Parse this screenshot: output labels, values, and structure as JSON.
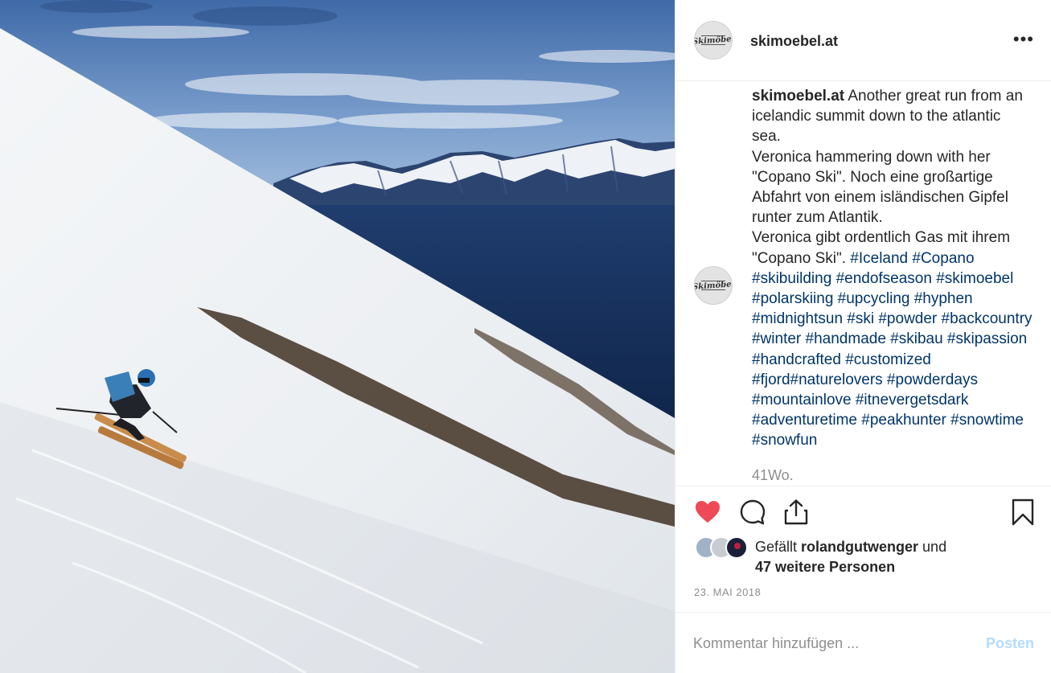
{
  "post": {
    "image": {
      "description": "skier descending snowy slope above fjord"
    },
    "author": {
      "username": "skimoebel.at",
      "avatar_logo_text": "Skimöbel"
    },
    "menu_icon": "more-dots-icon",
    "caption": {
      "username": "skimoebel.at",
      "text": " Another great run from an icelandic summit down to the atlantic sea.\nVeronica hammering down with her \"Copano Ski\". Noch eine großartige Abfahrt von einem isländischen Gipfel runter zum Atlantik.\nVeronica gibt ordentlich Gas mit ihrem \"Copano Ski\". ",
      "hashtags": "#Iceland #Copano #skibuilding #endofseason #skimoebel #polarskiing #upcycling #hyphen #midnightsun #ski #powder #backcountry #winter #handmade #skibau #skipassion #handcrafted #customized #fjord#naturelovers #powderdays #mountainlove #itnevergetsdark #adventuretime #peakhunter #snowtime #snowfun",
      "age": "41Wo."
    },
    "actions": {
      "like_icon": "heart-filled-icon",
      "comment_icon": "comment-icon",
      "share_icon": "share-icon",
      "save_icon": "bookmark-icon",
      "liked": true,
      "like_color": "#ed4956"
    },
    "likes": {
      "prefix": "Gefällt ",
      "user": "rolandgutwenger",
      "middle": " und",
      "others": "47 weitere Personen"
    },
    "date": "23. MAI 2018",
    "comment": {
      "placeholder": "Kommentar hinzufügen ...",
      "post_label": "Posten"
    }
  },
  "colors": {
    "hashtag": "#003569",
    "muted": "#8e8e8e",
    "post_button_disabled": "#b3dbff"
  }
}
